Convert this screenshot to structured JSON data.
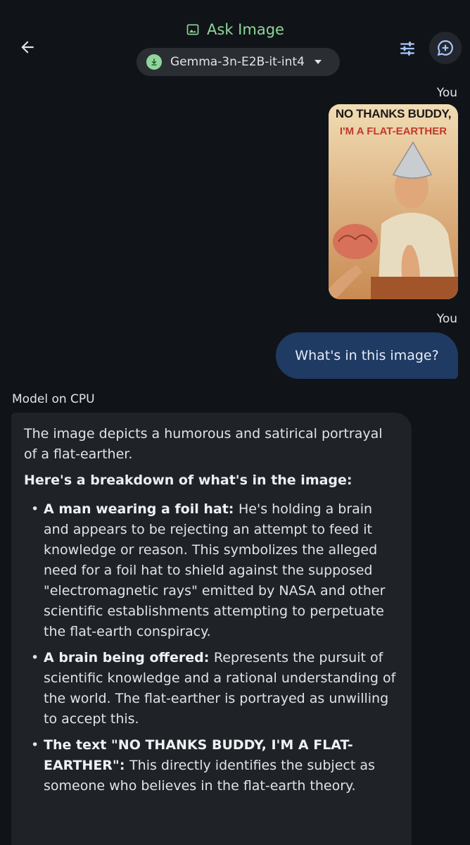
{
  "header": {
    "title": "Ask Image",
    "model_name": "Gemma-3n-E2B-it-int4"
  },
  "messages": {
    "user_label_1": "You",
    "image_caption_line1": "NO THANKS BUDDY,",
    "image_caption_line2": "I'M A FLAT-EARTHER",
    "user_label_2": "You",
    "user_text": "What's in this image?",
    "model_label": "Model on CPU",
    "model_intro": "The image depicts a humorous and satirical portrayal of a flat-earther.",
    "model_heading": "Here's a breakdown of what's in the image:",
    "bullets": [
      {
        "title": "A man wearing a foil hat:",
        "text": "He's holding a brain and appears to be rejecting an attempt to feed it knowledge or reason. This symbolizes the alleged need for a foil hat to shield against the supposed \"electromagnetic rays\" emitted by NASA and other scientific establishments attempting to perpetuate the flat-earth conspiracy."
      },
      {
        "title": "A brain being offered:",
        "text": "Represents the pursuit of scientific knowledge and a rational understanding of the world. The flat-earther is portrayed as unwilling to accept this."
      },
      {
        "title": "The text \"NO THANKS BUDDY, I'M A FLAT-EARTHER\":",
        "text": "This directly identifies the subject as someone who believes in the flat-earth theory."
      }
    ]
  },
  "colors": {
    "background": "#101418",
    "accent_green": "#8fd69a",
    "user_bubble": "#1f3a63",
    "model_bubble": "#1f2226"
  },
  "icons": {
    "back": "arrow-back-icon",
    "title": "image-icon",
    "download": "download-icon",
    "tune": "tune-icon",
    "new_chat": "add-chat-icon"
  }
}
